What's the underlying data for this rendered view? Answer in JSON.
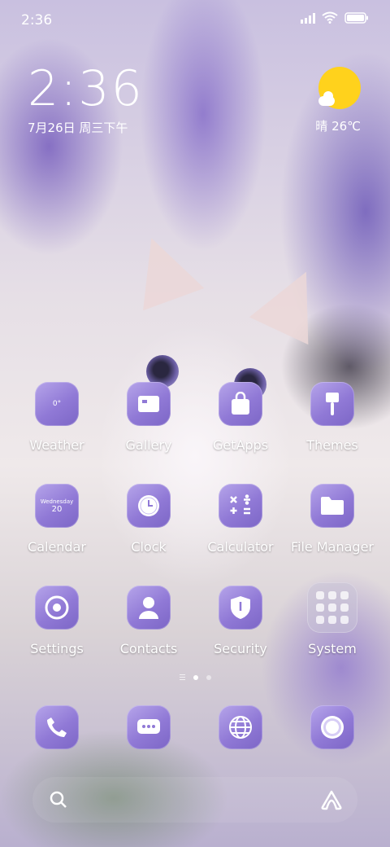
{
  "status_bar": {
    "time": "2:36"
  },
  "clock_widget": {
    "time": "2:36",
    "date": "7月26日 周三下午"
  },
  "weather_widget": {
    "condition": "晴",
    "temperature": "26℃"
  },
  "apps": {
    "weather": {
      "label": "Weather",
      "icon_text": "0°"
    },
    "gallery": {
      "label": "Gallery"
    },
    "getapps": {
      "label": "GetApps"
    },
    "themes": {
      "label": "Themes"
    },
    "calendar": {
      "label": "Calendar",
      "icon_day": "Wednesday",
      "icon_date": "20"
    },
    "clock": {
      "label": "Clock"
    },
    "calculator": {
      "label": "Calculator"
    },
    "file_manager": {
      "label": "File Manager"
    },
    "settings": {
      "label": "Settings"
    },
    "contacts": {
      "label": "Contacts"
    },
    "security": {
      "label": "Security"
    },
    "system": {
      "label": "System"
    }
  },
  "dock": [
    "phone-icon",
    "messages-icon",
    "browser-icon",
    "camera-icon"
  ],
  "page_indicator": {
    "pages": 2,
    "current": 1
  },
  "colors": {
    "icon_purple": "#9079d6",
    "sun": "#ffd21c",
    "text": "#ffffff"
  }
}
